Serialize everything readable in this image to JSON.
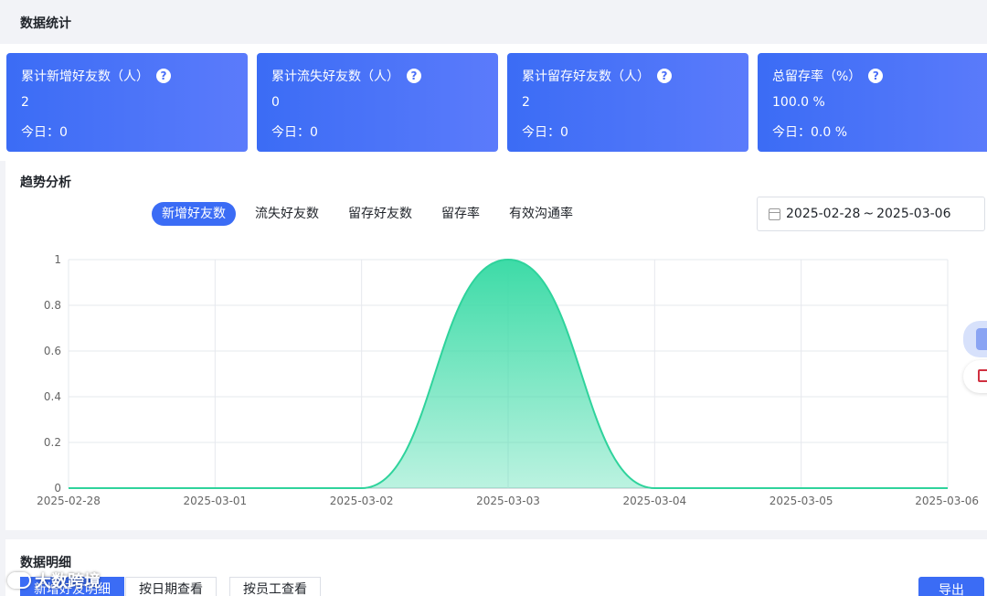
{
  "stats_title": "数据统计",
  "cards": [
    {
      "label": "累计新增好友数（人）",
      "value": "2",
      "today_label": "今日：",
      "today_value": "0"
    },
    {
      "label": "累计流失好友数（人）",
      "value": "0",
      "today_label": "今日：",
      "today_value": "0"
    },
    {
      "label": "累计留存好友数（人）",
      "value": "2",
      "today_label": "今日：",
      "today_value": "0"
    },
    {
      "label": "总留存率（%）",
      "value": "100.0 %",
      "today_label": "今日：",
      "today_value": "0.0 %"
    }
  ],
  "help_glyph": "?",
  "trend_title": "趋势分析",
  "tabs": [
    "新增好友数",
    "流失好友数",
    "留存好友数",
    "留存率",
    "有效沟通率"
  ],
  "date_range": {
    "start": "2025-02-28",
    "separator": "~",
    "end": "2025-03-06"
  },
  "chart_data": {
    "type": "area",
    "x": [
      "2025-02-28",
      "2025-03-01",
      "2025-03-02",
      "2025-03-03",
      "2025-03-04",
      "2025-03-05",
      "2025-03-06"
    ],
    "values": [
      0,
      0,
      0,
      1,
      0,
      0,
      0
    ],
    "ylim": [
      0,
      1
    ],
    "yticks": [
      "0",
      "0.2",
      "0.4",
      "0.6",
      "0.8",
      "1"
    ],
    "grid": true,
    "smooth": true,
    "color": "#3ddba7"
  },
  "detail_title": "数据明细",
  "detail_tabs": [
    "新增好友明细",
    "按日期查看",
    "按员工查看"
  ],
  "export_label": "导出",
  "brand_text": "大数跨境",
  "colors": {
    "primary": "#3b6cf5",
    "accent": "#3ddba7"
  }
}
